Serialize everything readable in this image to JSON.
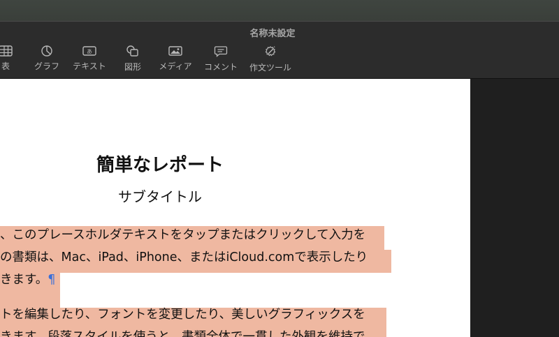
{
  "window": {
    "title": "名称未設定"
  },
  "toolbar": {
    "items": [
      {
        "label": "表",
        "icon": "table-icon"
      },
      {
        "label": "グラフ",
        "icon": "chart-icon"
      },
      {
        "label": "テキスト",
        "icon": "textbox-icon"
      },
      {
        "label": "図形",
        "icon": "shape-icon"
      },
      {
        "label": "メディア",
        "icon": "media-icon"
      },
      {
        "label": "コメント",
        "icon": "comment-icon"
      },
      {
        "label": "作文ツール",
        "icon": "writing-tools-icon"
      }
    ]
  },
  "document": {
    "title": "簡単なレポート",
    "subtitle": "サブタイトル",
    "paragraph1": {
      "line1": "、このプレースホルダテキストをタップまたはクリックして入力を",
      "line2": "の書類は、Mac、iPad、iPhone、またはiCloud.comで表示したり",
      "line3": "きます。",
      "pilcrow": "¶"
    },
    "paragraph2": {
      "line1": "トを編集したり、フォントを変更したり、美しいグラフィックスを",
      "line2": "きます。段落スタイルを使うと、書類全体で一貫した外観を維持で"
    }
  },
  "colors": {
    "selection_highlight": "#efb8a1",
    "toolbar_bg": "#2c2c2c",
    "pilcrow": "#3b6fd8"
  }
}
